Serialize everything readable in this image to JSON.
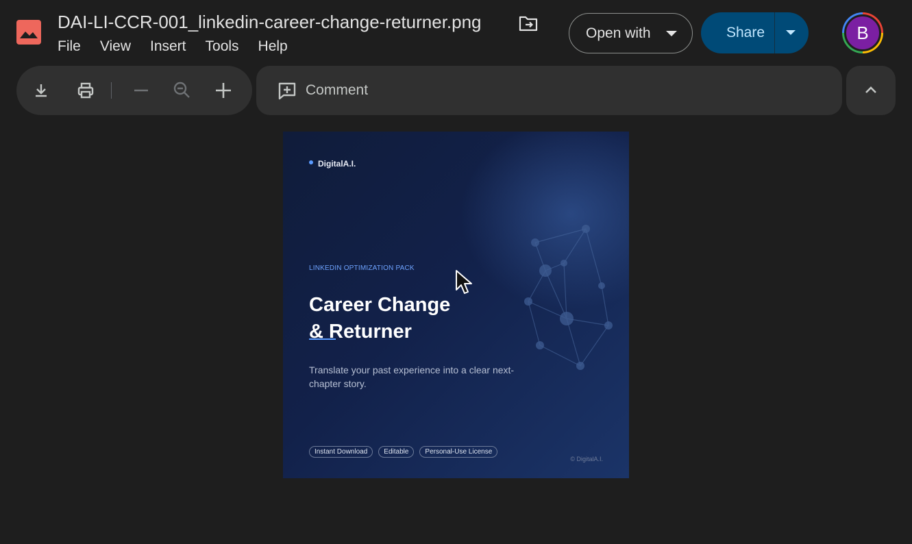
{
  "file": {
    "name": "DAI-LI-CCR-001_linkedin-career-change-returner.png",
    "icon": "image-file-icon"
  },
  "menu": [
    "File",
    "View",
    "Insert",
    "Tools",
    "Help"
  ],
  "actions": {
    "open_with": "Open with",
    "share": "Share"
  },
  "user": {
    "initial": "B",
    "avatar_color": "#7b1fa2"
  },
  "toolbar": {
    "comment": "Comment",
    "icons": [
      "download-icon",
      "print-icon",
      "zoom-out-icon",
      "zoom-reset-icon",
      "zoom-in-icon",
      "collapse-icon"
    ]
  },
  "preview": {
    "brand": "DigitalA.I.",
    "kicker": "LINKEDIN OPTIMIZATION PACK",
    "title_line1": "Career Change",
    "title_line2": "& Returner",
    "subtitle": "Translate your past experience into a clear next-chapter story.",
    "tags": [
      "Instant Download",
      "Editable",
      "Personal-Use License"
    ],
    "copyright": "© DigitalA.I."
  },
  "colors": {
    "background": "#1e1e1e",
    "panel": "#303030",
    "share_bg": "#004a77",
    "accent_blue": "#5b9bff"
  }
}
